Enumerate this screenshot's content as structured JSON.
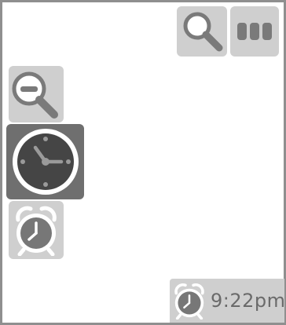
{
  "toolbar": {
    "search_icon": "search-icon",
    "menu_icon": "menu-icon"
  },
  "sidebar": {
    "zoom_out_icon": "zoom-out-icon",
    "clock_icon": "clock-icon",
    "alarm_icon": "alarm-clock-icon"
  },
  "status": {
    "alarm_icon": "alarm-clock-icon",
    "time": "9:22pm"
  },
  "colors": {
    "tile": "#cfcfcf",
    "clock_tile": "#6f6f6f",
    "clock_face": "#454545",
    "frame": "#8f8f8f",
    "icon_gray": "#777777"
  }
}
